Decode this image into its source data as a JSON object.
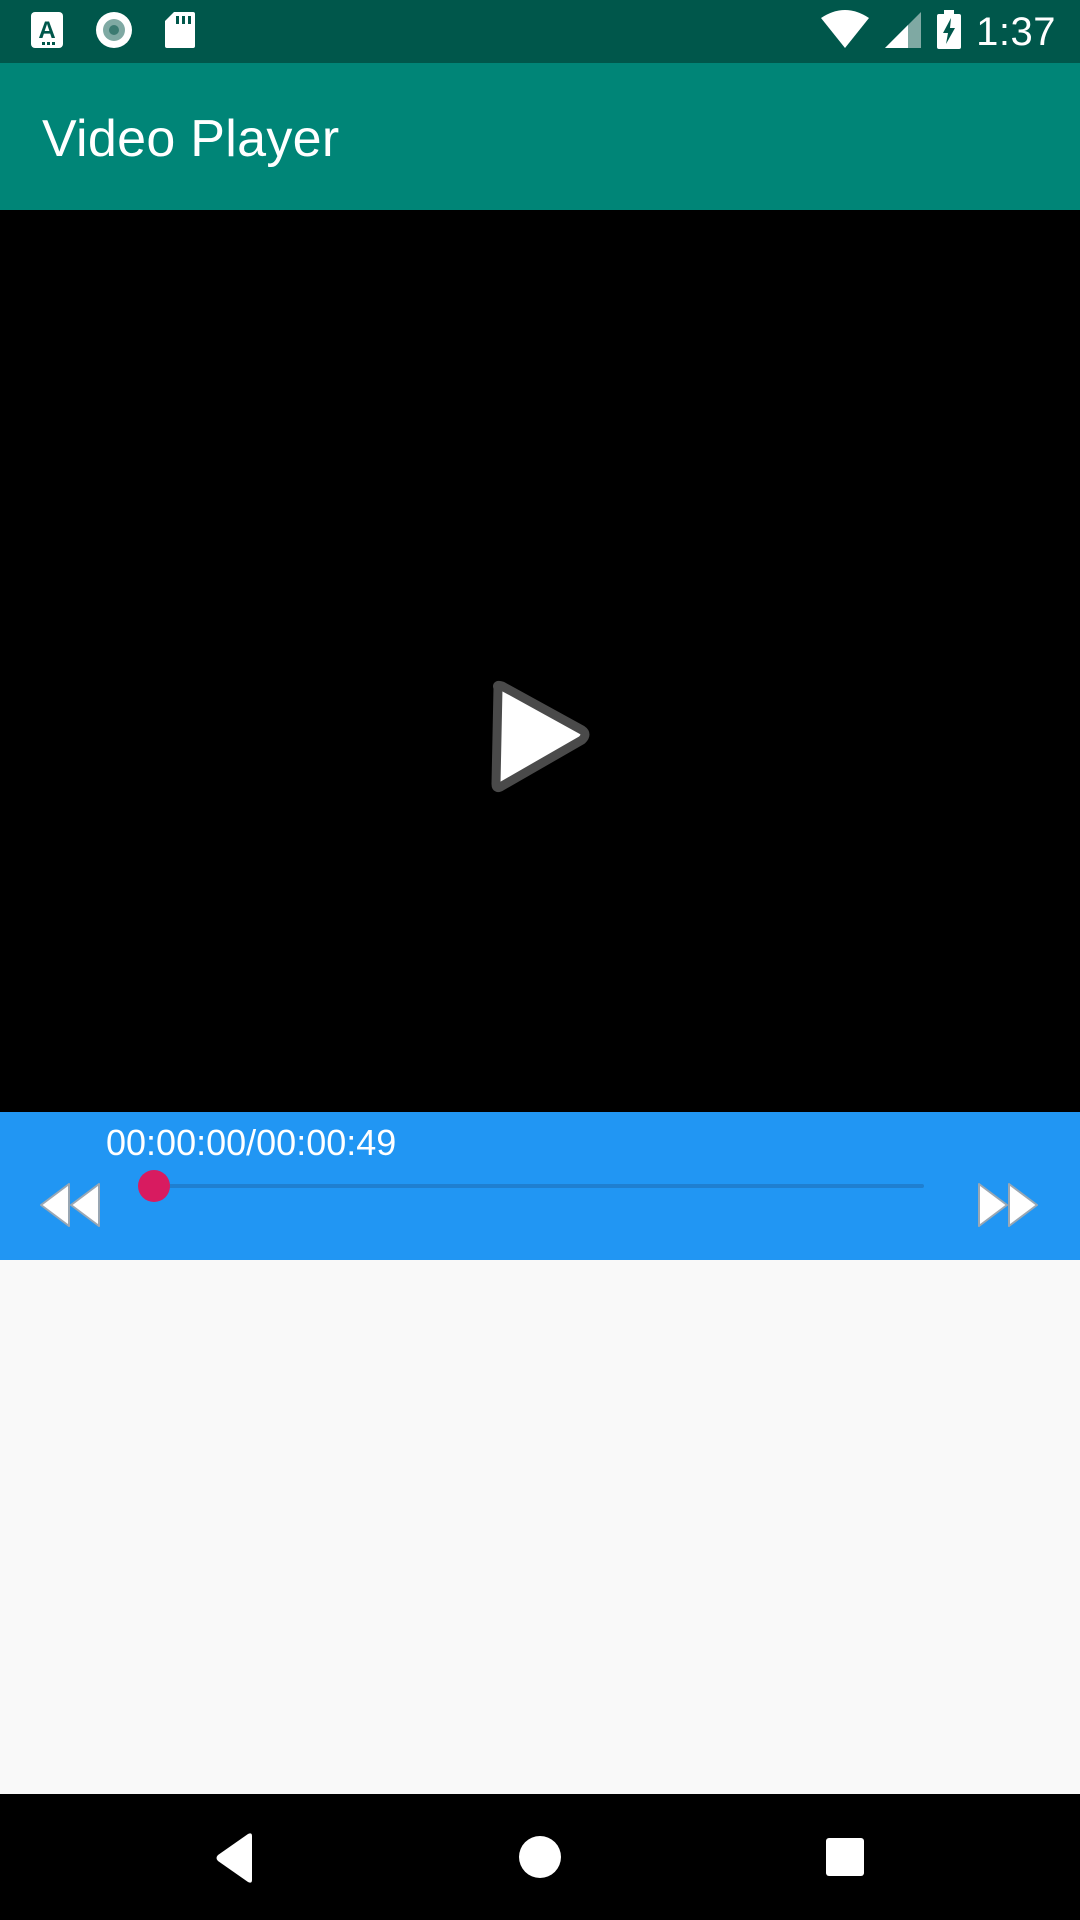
{
  "status_bar": {
    "time": "1:37",
    "icons": [
      "text-a-icon",
      "record-icon",
      "sd-card-icon",
      "wifi-icon",
      "signal-icon",
      "battery-charging-icon"
    ]
  },
  "app_bar": {
    "title": "Video Player"
  },
  "video": {
    "center_icon": "play-icon"
  },
  "controls": {
    "current_time": "00:00:00",
    "separator": "/",
    "total_time": "00:00:49",
    "progress": 0.0,
    "rewind_icon": "rewind-icon",
    "fast_forward_icon": "fast-forward-icon"
  },
  "nav_bar": {
    "icons": [
      "back-icon",
      "home-icon",
      "recents-icon"
    ]
  },
  "colors": {
    "status_bar": "#00574b",
    "app_bar": "#008577",
    "controls_bar": "#2196f3",
    "seek_thumb": "#d81b60",
    "background": "#f9f9f9"
  }
}
